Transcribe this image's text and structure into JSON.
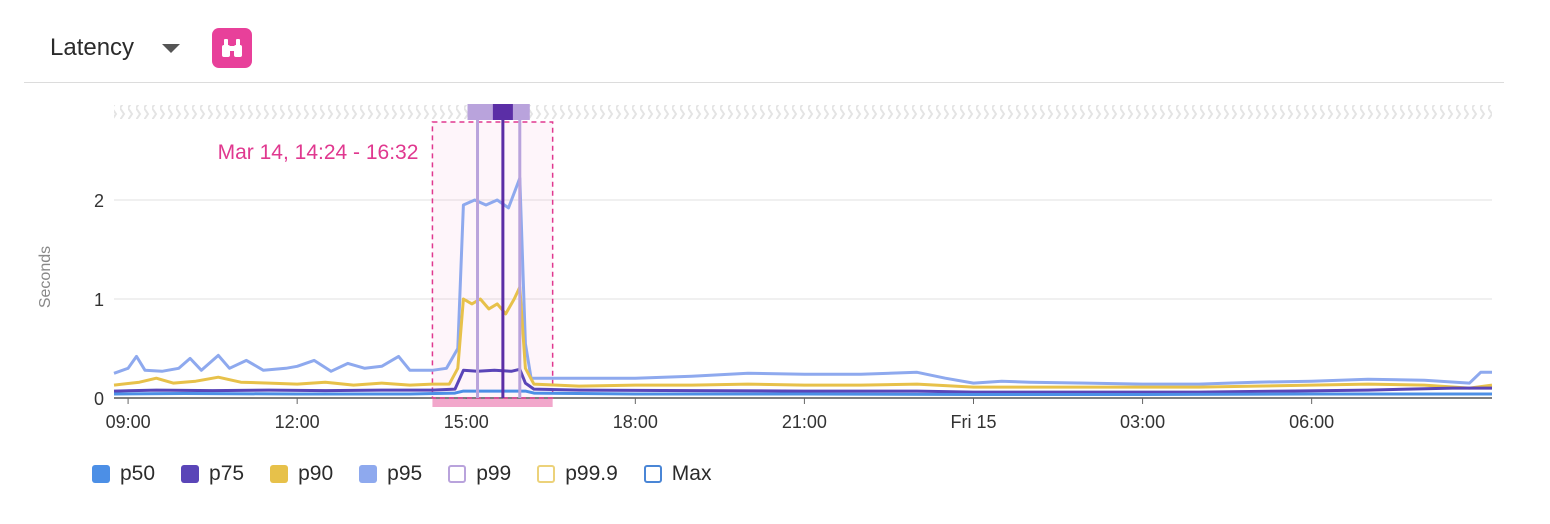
{
  "header": {
    "title": "Latency",
    "icon": "binoculars-icon",
    "accent": "#e8409a"
  },
  "selection": {
    "label": "Mar 14, 14:24 - 16:32",
    "start_hour": 14.4,
    "end_hour": 16.533,
    "color": "#e0388f"
  },
  "markers": [
    {
      "hour": 15.2,
      "kind": "light",
      "color": "#b9a3dc"
    },
    {
      "hour": 15.65,
      "kind": "dark",
      "color": "#5b2ea6"
    },
    {
      "hour": 15.95,
      "kind": "light",
      "color": "#b9a3dc"
    }
  ],
  "chart_data": {
    "type": "line",
    "ylabel": "Seconds",
    "ylim": [
      0,
      2.2
    ],
    "y_ticks": [
      0,
      1,
      2
    ],
    "x_start_hour": 8.75,
    "x_end_hour": 33.2,
    "x_ticks": [
      {
        "hour": 9,
        "label": "09:00"
      },
      {
        "hour": 12,
        "label": "12:00"
      },
      {
        "hour": 15,
        "label": "15:00"
      },
      {
        "hour": 18,
        "label": "18:00"
      },
      {
        "hour": 21,
        "label": "21:00"
      },
      {
        "hour": 24,
        "label": "Fri 15"
      },
      {
        "hour": 27,
        "label": "03:00"
      },
      {
        "hour": 30,
        "label": "06:00"
      }
    ],
    "series": [
      {
        "name": "p50",
        "color": "#4c8fe6",
        "filled": true,
        "points": [
          [
            8.75,
            0.04
          ],
          [
            10,
            0.045
          ],
          [
            12,
            0.04
          ],
          [
            14,
            0.04
          ],
          [
            14.8,
            0.05
          ],
          [
            14.95,
            0.07
          ],
          [
            15.2,
            0.07
          ],
          [
            16.05,
            0.07
          ],
          [
            16.2,
            0.05
          ],
          [
            18,
            0.04
          ],
          [
            21,
            0.04
          ],
          [
            24,
            0.035
          ],
          [
            27,
            0.035
          ],
          [
            30,
            0.04
          ],
          [
            33.2,
            0.04
          ]
        ]
      },
      {
        "name": "p75",
        "color": "#5a45b8",
        "filled": true,
        "points": [
          [
            8.75,
            0.07
          ],
          [
            9.5,
            0.08
          ],
          [
            10.5,
            0.075
          ],
          [
            11.5,
            0.08
          ],
          [
            12.5,
            0.075
          ],
          [
            13.5,
            0.08
          ],
          [
            14.4,
            0.08
          ],
          [
            14.8,
            0.09
          ],
          [
            14.95,
            0.28
          ],
          [
            15.2,
            0.27
          ],
          [
            15.5,
            0.28
          ],
          [
            15.8,
            0.27
          ],
          [
            15.95,
            0.29
          ],
          [
            16.05,
            0.15
          ],
          [
            16.2,
            0.09
          ],
          [
            17,
            0.08
          ],
          [
            19,
            0.075
          ],
          [
            21,
            0.07
          ],
          [
            23,
            0.07
          ],
          [
            24,
            0.06
          ],
          [
            26,
            0.06
          ],
          [
            28,
            0.06
          ],
          [
            29.5,
            0.07
          ],
          [
            31,
            0.08
          ],
          [
            32.5,
            0.1
          ],
          [
            33.2,
            0.1
          ]
        ]
      },
      {
        "name": "p90",
        "color": "#e7c14a",
        "filled": true,
        "points": [
          [
            8.75,
            0.13
          ],
          [
            9.2,
            0.16
          ],
          [
            9.5,
            0.2
          ],
          [
            9.8,
            0.15
          ],
          [
            10.2,
            0.17
          ],
          [
            10.6,
            0.21
          ],
          [
            11,
            0.16
          ],
          [
            11.5,
            0.15
          ],
          [
            12,
            0.14
          ],
          [
            12.5,
            0.16
          ],
          [
            13,
            0.13
          ],
          [
            13.5,
            0.15
          ],
          [
            14,
            0.13
          ],
          [
            14.4,
            0.14
          ],
          [
            14.7,
            0.14
          ],
          [
            14.85,
            0.3
          ],
          [
            14.95,
            1.0
          ],
          [
            15.1,
            0.95
          ],
          [
            15.25,
            1.0
          ],
          [
            15.4,
            0.9
          ],
          [
            15.55,
            0.95
          ],
          [
            15.7,
            0.85
          ],
          [
            15.85,
            1.0
          ],
          [
            15.95,
            1.12
          ],
          [
            16.05,
            0.3
          ],
          [
            16.2,
            0.14
          ],
          [
            17,
            0.12
          ],
          [
            18,
            0.13
          ],
          [
            19,
            0.13
          ],
          [
            20,
            0.14
          ],
          [
            21,
            0.13
          ],
          [
            22,
            0.13
          ],
          [
            23,
            0.14
          ],
          [
            24,
            0.11
          ],
          [
            25,
            0.11
          ],
          [
            26,
            0.11
          ],
          [
            27,
            0.11
          ],
          [
            28,
            0.11
          ],
          [
            29,
            0.12
          ],
          [
            30,
            0.13
          ],
          [
            31,
            0.14
          ],
          [
            32,
            0.13
          ],
          [
            32.8,
            0.1
          ],
          [
            33.2,
            0.13
          ]
        ]
      },
      {
        "name": "p95",
        "color": "#8ea9ee",
        "filled": true,
        "points": [
          [
            8.75,
            0.25
          ],
          [
            9,
            0.3
          ],
          [
            9.15,
            0.42
          ],
          [
            9.3,
            0.28
          ],
          [
            9.6,
            0.27
          ],
          [
            9.9,
            0.3
          ],
          [
            10.1,
            0.4
          ],
          [
            10.3,
            0.28
          ],
          [
            10.6,
            0.43
          ],
          [
            10.8,
            0.3
          ],
          [
            11.1,
            0.38
          ],
          [
            11.4,
            0.28
          ],
          [
            11.8,
            0.3
          ],
          [
            12,
            0.32
          ],
          [
            12.3,
            0.38
          ],
          [
            12.6,
            0.27
          ],
          [
            12.9,
            0.35
          ],
          [
            13.2,
            0.3
          ],
          [
            13.5,
            0.32
          ],
          [
            13.8,
            0.42
          ],
          [
            14.0,
            0.28
          ],
          [
            14.4,
            0.28
          ],
          [
            14.65,
            0.3
          ],
          [
            14.85,
            0.5
          ],
          [
            14.95,
            1.95
          ],
          [
            15.15,
            2.0
          ],
          [
            15.35,
            1.95
          ],
          [
            15.55,
            2.0
          ],
          [
            15.75,
            1.92
          ],
          [
            15.95,
            2.22
          ],
          [
            16.05,
            0.55
          ],
          [
            16.15,
            0.2
          ],
          [
            16.5,
            0.2
          ],
          [
            17,
            0.2
          ],
          [
            18,
            0.2
          ],
          [
            19,
            0.22
          ],
          [
            20,
            0.25
          ],
          [
            21,
            0.24
          ],
          [
            22,
            0.24
          ],
          [
            23,
            0.26
          ],
          [
            23.5,
            0.2
          ],
          [
            24,
            0.15
          ],
          [
            24.5,
            0.17
          ],
          [
            25,
            0.16
          ],
          [
            26,
            0.15
          ],
          [
            27,
            0.14
          ],
          [
            28,
            0.14
          ],
          [
            29,
            0.16
          ],
          [
            30,
            0.17
          ],
          [
            31,
            0.19
          ],
          [
            32,
            0.18
          ],
          [
            32.8,
            0.15
          ],
          [
            33,
            0.26
          ],
          [
            33.2,
            0.26
          ]
        ]
      },
      {
        "name": "p99",
        "color": "#b9a3dc",
        "filled": false,
        "points": []
      },
      {
        "name": "p99.9",
        "color": "#ecd27a",
        "filled": false,
        "points": []
      },
      {
        "name": "Max",
        "color": "#4a86d6",
        "filled": false,
        "points": []
      }
    ]
  }
}
